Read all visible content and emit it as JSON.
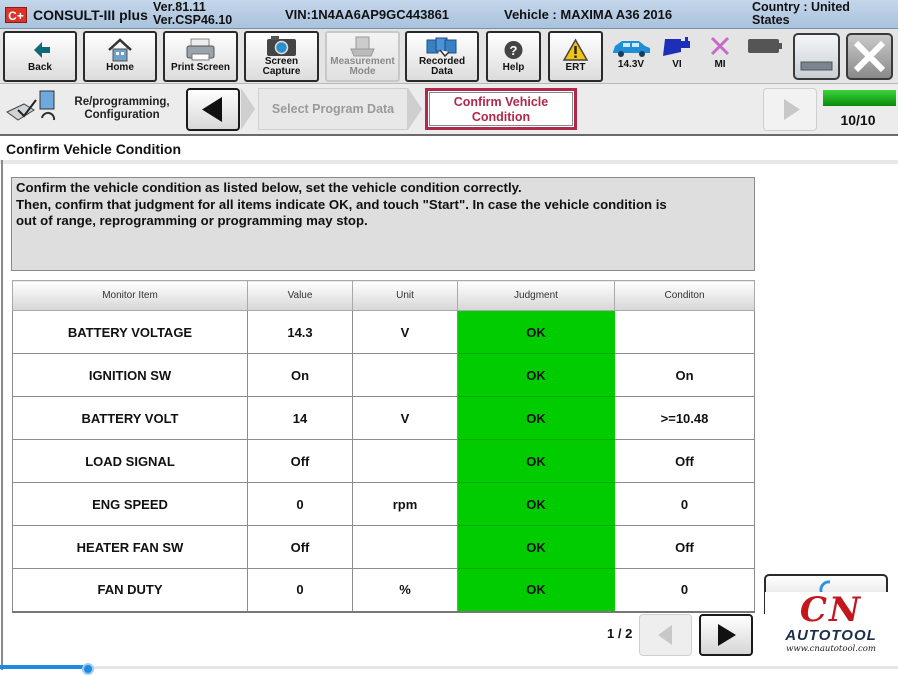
{
  "titlebar": {
    "logo": "C+",
    "app_title": "CONSULT-III plus",
    "version_line1": "Ver.81.11",
    "version_line2": "Ver.CSP46.10",
    "vin": "VIN:1N4AA6AP9GC443861",
    "vehicle": "Vehicle : MAXIMA A36 2016",
    "country_line1": "Country : United",
    "country_line2": "States"
  },
  "toolbar": {
    "back": "Back",
    "home": "Home",
    "print_screen": "Print Screen",
    "screen_capture_1": "Screen",
    "screen_capture_2": "Capture",
    "measurement_mode_1": "Measurement",
    "measurement_mode_2": "Mode",
    "recorded_data_1": "Recorded",
    "recorded_data_2": "Data",
    "help": "Help",
    "ert": "ERT",
    "battery_voltage": "14.3V",
    "vi": "VI",
    "mi": "MI"
  },
  "nav": {
    "section_line1": "Re/programming,",
    "section_line2": "Configuration",
    "prev_step": "Select Program Data",
    "current_step_line1": "Confirm Vehicle",
    "current_step_line2": "Condition",
    "progress_text": "10/10",
    "progress_fraction": 1.0
  },
  "page_title": "Confirm Vehicle Condition",
  "message": {
    "line1": "Confirm the vehicle condition as listed below, set the vehicle condition correctly.",
    "line2": "Then, confirm that judgment for all items indicate OK, and touch \"Start\". In case the vehicle condition is",
    "line3": "out of range, reprogramming or programming may stop."
  },
  "table": {
    "headers": [
      "Monitor Item",
      "Value",
      "Unit",
      "Judgment",
      "Conditon"
    ],
    "rows": [
      {
        "item": "BATTERY VOLTAGE",
        "value": "14.3",
        "unit": "V",
        "judgment": "OK",
        "condition": ""
      },
      {
        "item": "IGNITION SW",
        "value": "On",
        "unit": "",
        "judgment": "OK",
        "condition": "On"
      },
      {
        "item": "BATTERY VOLT",
        "value": "14",
        "unit": "V",
        "judgment": "OK",
        "condition": ">=10.48"
      },
      {
        "item": "LOAD SIGNAL",
        "value": "Off",
        "unit": "",
        "judgment": "OK",
        "condition": "Off"
      },
      {
        "item": "ENG SPEED",
        "value": "0",
        "unit": "rpm",
        "judgment": "OK",
        "condition": "0"
      },
      {
        "item": "HEATER FAN SW",
        "value": "Off",
        "unit": "",
        "judgment": "OK",
        "condition": "Off"
      },
      {
        "item": "FAN DUTY",
        "value": "0",
        "unit": "%",
        "judgment": "OK",
        "condition": "0"
      }
    ]
  },
  "pagination": {
    "text": "1 / 2"
  },
  "watermark": {
    "brand": "CN",
    "name": "AUTOTOOL",
    "url": "www.cnautotool.com"
  },
  "colors": {
    "judgment_ok": "#00cc00",
    "active_step": "#b0294a",
    "titlebar": "#b7cce3"
  }
}
